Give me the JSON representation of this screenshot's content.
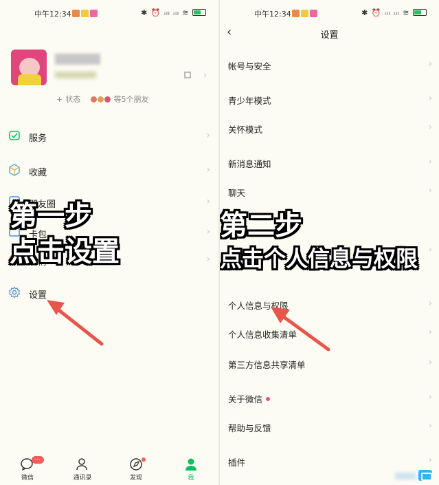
{
  "left": {
    "statusbar": {
      "time": "中午12:34",
      "right": "✱ ⏰ ᵢₗₗ ᵢₗₗ ≋"
    },
    "profile": {
      "status_label": "状态",
      "friends_label": "等5个朋友"
    },
    "menu": [
      {
        "label": "服务",
        "icon": "service-icon"
      },
      {
        "label": "收藏",
        "icon": "favorites-icon"
      },
      {
        "label": "朋友圈",
        "icon": "moments-icon"
      },
      {
        "label": "卡包",
        "icon": "cards-icon"
      },
      {
        "label": "表情",
        "icon": "stickers-icon"
      },
      {
        "label": "设置",
        "icon": "settings-gear-icon"
      }
    ],
    "overlay": {
      "line1": "第一步",
      "line2": "点击设置"
    },
    "tabs": [
      {
        "label": "微信",
        "icon": "chat-icon",
        "badge": "···"
      },
      {
        "label": "通讯录",
        "icon": "contacts-icon"
      },
      {
        "label": "发现",
        "icon": "discover-compass-icon"
      },
      {
        "label": "我",
        "icon": "me-person-icon"
      }
    ]
  },
  "right": {
    "statusbar": {
      "time": "中午12:34",
      "right": "✱ ⏰ ᵢₗₗ ᵢₗₗ ≋"
    },
    "nav": {
      "back": "‹",
      "title": "设置"
    },
    "items": [
      {
        "label": "帐号与安全"
      },
      {
        "label": "青少年模式"
      },
      {
        "label": "关怀模式"
      },
      {
        "label": "新消息通知"
      },
      {
        "label": "聊天"
      },
      {
        "label": "隐私"
      },
      {
        "label": "个人信息与权限"
      },
      {
        "label": "个人信息收集清单"
      },
      {
        "label": "第三方信息共享清单"
      },
      {
        "label": "关于微信",
        "dot": true
      },
      {
        "label": "帮助与反馈"
      },
      {
        "label": "插件"
      }
    ],
    "overlay": {
      "line1": "第二步",
      "line2": "点击个人信息与权限"
    }
  },
  "colors": {
    "accent_green": "#07c160",
    "arrow_red": "#e8554a",
    "badge_red": "#f25d5d"
  }
}
